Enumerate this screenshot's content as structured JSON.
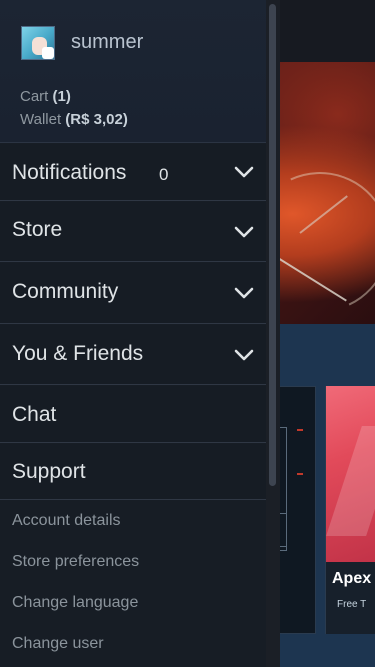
{
  "profile": {
    "username": "summer",
    "cart_label": "Cart",
    "cart_count": "(1)",
    "wallet_label": "Wallet",
    "wallet_value": "(R$ 3,02)"
  },
  "nav": {
    "notifications": {
      "label": "Notifications",
      "count": "0"
    },
    "store": {
      "label": "Store"
    },
    "community": {
      "label": "Community"
    },
    "you_friends": {
      "label": "You & Friends"
    },
    "chat": {
      "label": "Chat"
    },
    "support": {
      "label": "Support"
    }
  },
  "links": {
    "account_details": "Account details",
    "store_preferences": "Store preferences",
    "change_language": "Change language",
    "change_user": "Change user"
  },
  "background": {
    "card_title": "Apex",
    "card_subtitle": "Free T"
  },
  "colors": {
    "drawer_bg": "#171d25",
    "text_primary": "#dfe3e6",
    "text_muted": "#8b949c",
    "divider": "#2f3744"
  }
}
